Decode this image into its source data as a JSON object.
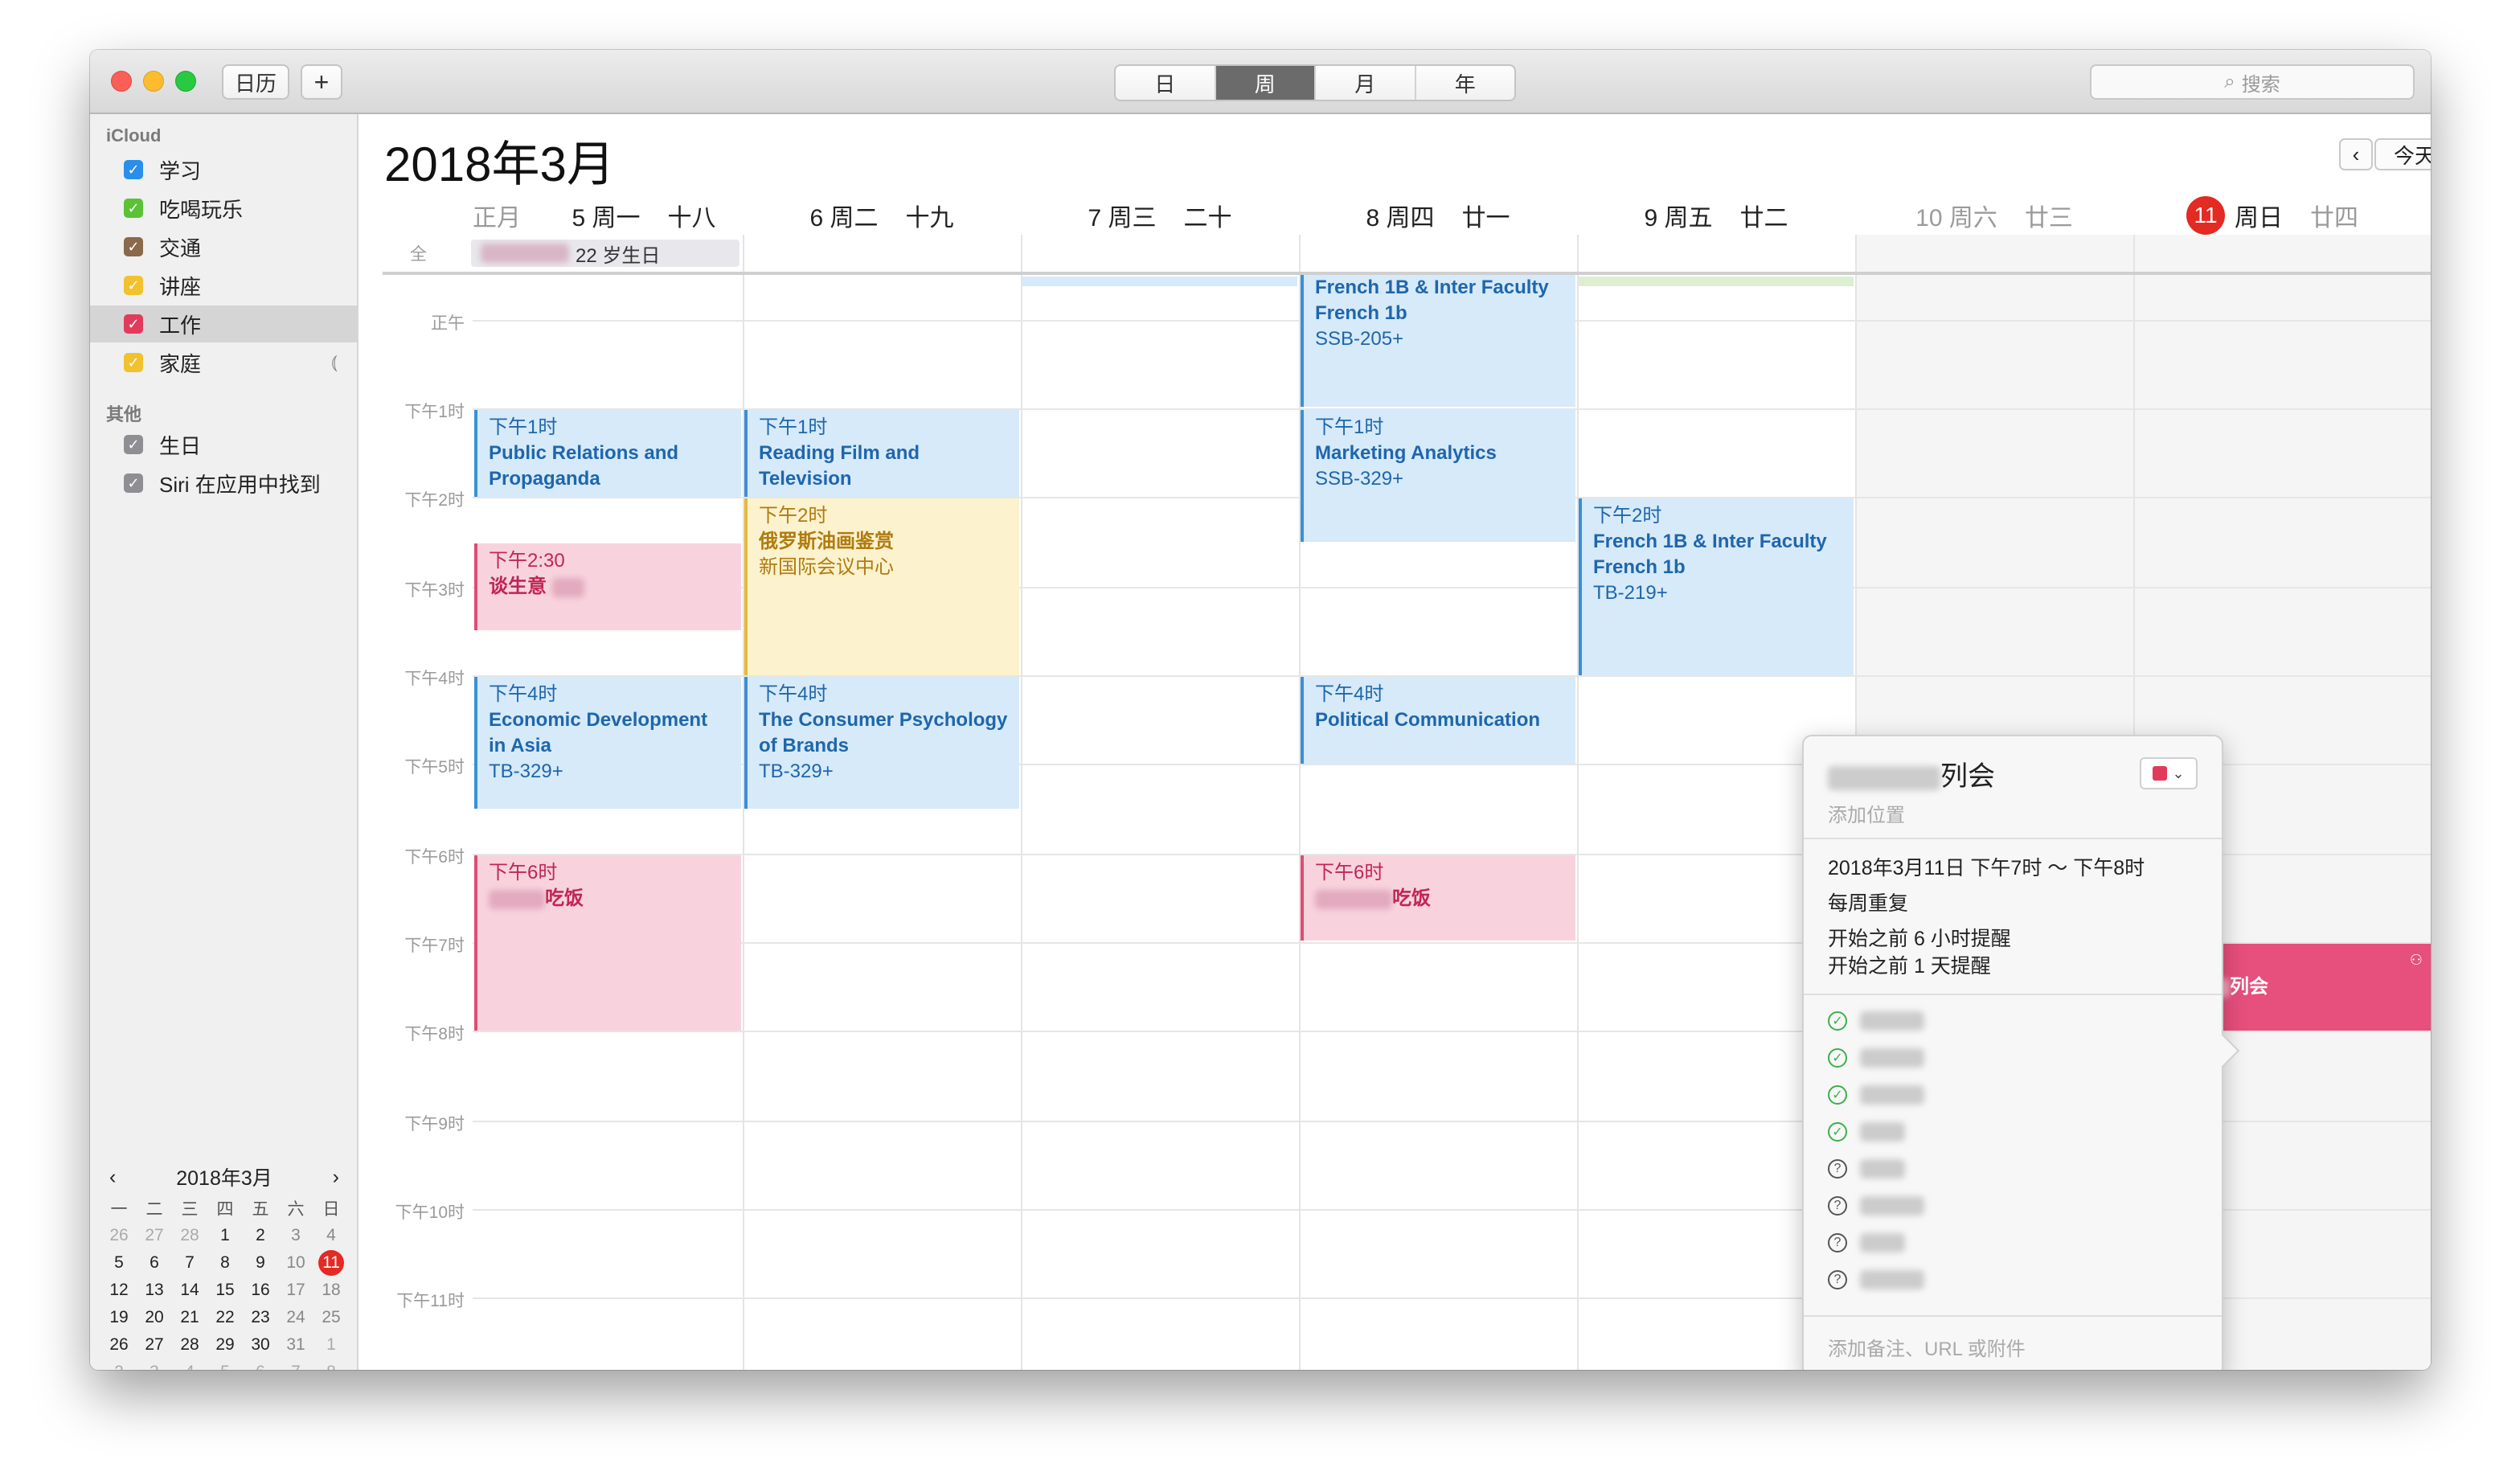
{
  "toolbar": {
    "calendars_label": "日历",
    "add_label": "+",
    "views": [
      "日",
      "周",
      "月",
      "年"
    ],
    "active_view": "周",
    "search_placeholder": "搜索"
  },
  "sidebar": {
    "icloud_header": "iCloud",
    "icloud_items": [
      {
        "label": "学习",
        "color": "#2a8fea"
      },
      {
        "label": "吃喝玩乐",
        "color": "#5bc236"
      },
      {
        "label": "交通",
        "color": "#8a6a4a"
      },
      {
        "label": "讲座",
        "color": "#f2c12e"
      },
      {
        "label": "工作",
        "color": "#e23a5c"
      },
      {
        "label": "家庭",
        "color": "#f2c12e"
      }
    ],
    "other_header": "其他",
    "other_items": [
      {
        "label": "生日",
        "color": "#8e8e93"
      },
      {
        "label": "Siri 在应用中找到",
        "color": "#8e8e93"
      }
    ]
  },
  "mini_calendar": {
    "title": "2018年3月",
    "weekdays": [
      "一",
      "二",
      "三",
      "四",
      "五",
      "六",
      "日"
    ],
    "days": [
      "26",
      "27",
      "28",
      "1",
      "2",
      "3",
      "4",
      "5",
      "6",
      "7",
      "8",
      "9",
      "10",
      "11",
      "12",
      "13",
      "14",
      "15",
      "16",
      "17",
      "18",
      "19",
      "20",
      "21",
      "22",
      "23",
      "24",
      "25",
      "26",
      "27",
      "28",
      "29",
      "30",
      "31",
      "1",
      "2",
      "3",
      "4",
      "5",
      "6",
      "7",
      "8"
    ],
    "today": "11"
  },
  "main": {
    "title": "2018年3月",
    "today_label": "今天",
    "lunar_month": "正月",
    "days": [
      {
        "date": "5 周一",
        "lunar": "十八"
      },
      {
        "date": "6 周二",
        "lunar": "十九"
      },
      {
        "date": "7 周三",
        "lunar": "二十"
      },
      {
        "date": "8 周四",
        "lunar": "廿一"
      },
      {
        "date": "9 周五",
        "lunar": "廿二"
      },
      {
        "date": "10 周六",
        "lunar": "廿三"
      },
      {
        "num": "11",
        "date": "周日",
        "lunar": "廿四"
      }
    ],
    "allday_label": "全",
    "allday_event": "22 岁生日",
    "hours": [
      "正午",
      "下午1时",
      "下午2时",
      "下午3时",
      "下午4时",
      "下午5时",
      "下午6时",
      "下午7时",
      "下午8时",
      "下午9时",
      "下午10时",
      "下午11时"
    ]
  },
  "events": {
    "thu_french": {
      "title": "French 1B & Inter Faculty French 1b",
      "loc": "SSB-205+"
    },
    "mon_pr": {
      "time": "下午1时",
      "title": "Public Relations and Propaganda"
    },
    "tue_film": {
      "time": "下午1时",
      "title": "Reading Film and Television"
    },
    "thu_mkt": {
      "time": "下午1时",
      "title": "Marketing Analytics",
      "loc": "SSB-329+"
    },
    "tue_oil": {
      "time": "下午2时",
      "title": "俄罗斯油画鉴赏",
      "loc": "新国际会议中心"
    },
    "fri_french": {
      "time": "下午2时",
      "title": "French 1B & Inter Faculty French 1b",
      "loc": "TB-219+"
    },
    "mon_biz": {
      "time": "下午2:30",
      "title": "谈生意"
    },
    "mon_econ": {
      "time": "下午4时",
      "title": "Economic Development in Asia",
      "loc": "TB-329+"
    },
    "tue_psych": {
      "time": "下午4时",
      "title": "The Consumer Psychology of Brands",
      "loc": "TB-329+"
    },
    "thu_pol": {
      "time": "下午4时",
      "title": "Political Communication"
    },
    "mon_dinner": {
      "time": "下午6时",
      "title": "吃饭"
    },
    "thu_dinner": {
      "time": "下午6时",
      "title": "吃饭"
    },
    "sun_meeting": {
      "time": "下午7时",
      "title": "列会"
    }
  },
  "popover": {
    "title": "列会",
    "location_placeholder": "添加位置",
    "datetime": "2018年3月11日  下午7时 ～ 下午8时",
    "repeat": "每周重复",
    "alert1": "开始之前 6 小时提醒",
    "alert2": "开始之前 1 天提醒",
    "notes_placeholder": "添加备注、URL 或附件",
    "color": "#e23a5c"
  }
}
